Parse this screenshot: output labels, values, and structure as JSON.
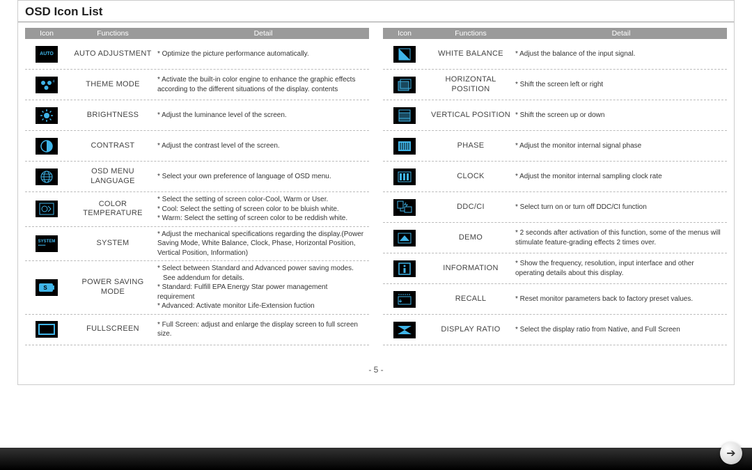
{
  "title": "OSD Icon List",
  "page_number": "- 5 -",
  "headers": {
    "icon": "Icon",
    "functions": "Functions",
    "detail": "Detail"
  },
  "left": [
    {
      "icon": "auto",
      "func": "AUTO ADJUSTMENT",
      "detail": [
        "Optimize the picture performance automatically."
      ]
    },
    {
      "icon": "theme",
      "func": "THEME MODE",
      "detail": [
        "Activate the built-in color engine to enhance the graphic effects according to the different situations of the display. contents"
      ]
    },
    {
      "icon": "brightness",
      "func": "BRIGHTNESS",
      "detail": [
        "Adjust the luminance level of the screen."
      ]
    },
    {
      "icon": "contrast",
      "func": "CONTRAST",
      "detail": [
        "Adjust the contrast level of the screen."
      ]
    },
    {
      "icon": "language",
      "func": "OSD MENU LANGUAGE",
      "detail": [
        "Select your own preference of language of OSD menu."
      ]
    },
    {
      "icon": "colortemp",
      "func": "COLOR TEMPERATURE",
      "detail": [
        "Select the setting of screen color-Cool, Warm or User.",
        "Cool: Select the setting of screen color to be bluish white.",
        "Warm: Select the setting of screen color to be reddish white."
      ]
    },
    {
      "icon": "system",
      "func": "SYSTEM",
      "detail": [
        "Adjust the mechanical specifications regarding the display.(Power Saving Mode, White Balance, Clock, Phase, Horizontal Position, Vertical Position, Information)"
      ]
    },
    {
      "icon": "power",
      "func": "POWER SAVING MODE",
      "detail": [
        "Select between Standard and Advanced power saving modes.",
        "_See addendum for details.",
        "Standard: Fulfill EPA Energy Star power management requirement",
        "Advanced: Activate monitor Life-Extension fuction"
      ]
    },
    {
      "icon": "fullscreen",
      "func": "FULLSCREEN",
      "detail": [
        "Full Screen: adjust and enlarge the display screen to full screen size."
      ]
    }
  ],
  "right": [
    {
      "icon": "whitebalance",
      "func": "WHITE BALANCE",
      "detail": [
        "Adjust the balance of the input signal."
      ]
    },
    {
      "icon": "hpos",
      "func": "HORIZONTAL POSITION",
      "detail": [
        "Shift the screen left or right"
      ]
    },
    {
      "icon": "vpos",
      "func": "VERTICAL POSITION",
      "detail": [
        "Shift the screen up or down"
      ]
    },
    {
      "icon": "phase",
      "func": "PHASE",
      "detail": [
        "Adjust the monitor internal signal phase"
      ]
    },
    {
      "icon": "clock",
      "func": "CLOCK",
      "detail": [
        "Adjust the monitor internal sampling clock rate"
      ]
    },
    {
      "icon": "ddcci",
      "func": "DDC/CI",
      "detail": [
        "Select turn on or turn off DDC/CI function"
      ]
    },
    {
      "icon": "demo",
      "func": "DEMO",
      "detail": [
        "2 seconds after activation of this function, some of the menus will stimulate feature-grading effects 2 times over."
      ]
    },
    {
      "icon": "info",
      "func": "INFORMATION",
      "detail": [
        "Show the frequency, resolution, input interface and other operating details about this display."
      ]
    },
    {
      "icon": "recall",
      "func": "RECALL",
      "detail": [
        "Reset monitor parameters back to factory preset values."
      ]
    },
    {
      "icon": "displayratio",
      "func": "DISPLAY RATIO",
      "detail": [
        "Select the display ratio from Native, and Full Screen"
      ]
    }
  ]
}
